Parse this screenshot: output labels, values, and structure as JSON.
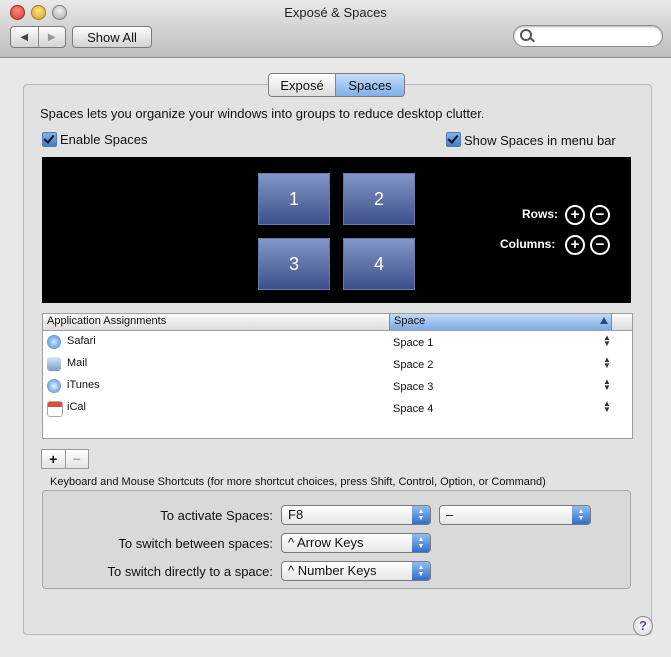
{
  "window": {
    "title": "Exposé & Spaces",
    "back_glyph": "◀",
    "forward_glyph": "▶",
    "show_all_label": "Show All",
    "search_placeholder": ""
  },
  "tabs": [
    {
      "label": "Exposé",
      "selected": false
    },
    {
      "label": "Spaces",
      "selected": true
    }
  ],
  "description": "Spaces lets you organize your windows into groups to reduce desktop clutter.",
  "options": {
    "enable_spaces": {
      "label": "Enable Spaces",
      "checked": true
    },
    "show_in_menu_bar": {
      "label": "Show Spaces in menu bar",
      "checked": true
    }
  },
  "spaces": [
    "1",
    "2",
    "3",
    "4"
  ],
  "grid_controls": {
    "rows_label": "Rows:",
    "columns_label": "Columns:",
    "plus_glyph": "+",
    "minus_glyph": "−"
  },
  "assignments": {
    "headers": {
      "application": "Application Assignments",
      "space": "Space"
    },
    "rows": [
      {
        "app": "Safari",
        "space": "Space 1",
        "icon": "safari-icon"
      },
      {
        "app": "Mail",
        "space": "Space 2",
        "icon": "mail-icon"
      },
      {
        "app": "iTunes",
        "space": "Space 3",
        "icon": "itunes-icon"
      },
      {
        "app": "iCal",
        "space": "Space 4",
        "icon": "ical-icon"
      }
    ],
    "add_glyph": "+",
    "remove_glyph": "−"
  },
  "shortcuts": {
    "title": "Keyboard and Mouse Shortcuts (for more shortcut choices, press Shift, Control, Option, or Command)",
    "activate": {
      "label": "To activate Spaces:",
      "key": "F8",
      "mouse": "–"
    },
    "switch_between": {
      "label": "To switch between spaces:",
      "value": "^ Arrow Keys"
    },
    "switch_directly": {
      "label": "To switch directly to a space:",
      "value": "^ Number Keys"
    }
  },
  "help_glyph": "?",
  "colors": {
    "selected_blue": "#7fb0ea",
    "space_tile": "#5a6ba4",
    "background": "#e8e8e8"
  }
}
